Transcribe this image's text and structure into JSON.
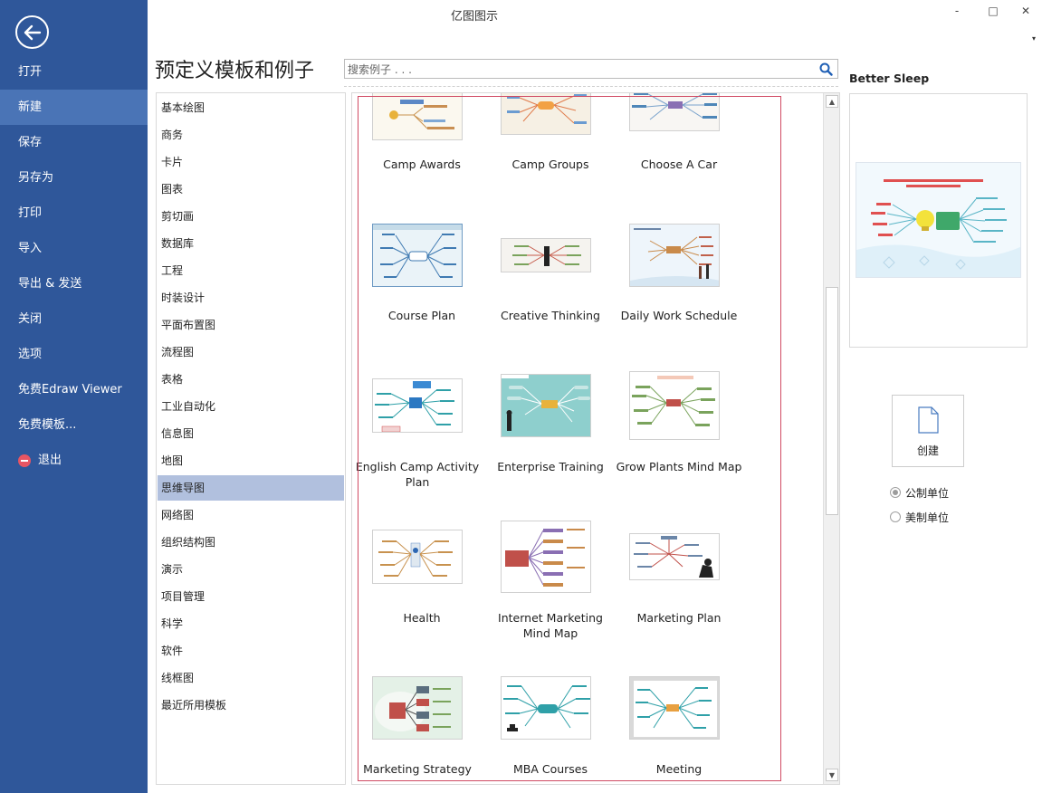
{
  "window": {
    "title": "亿图图示",
    "minimize": "-",
    "maximize": "□",
    "close": "✕",
    "ribbon_toggle": "▾"
  },
  "sidebar": {
    "back_icon": "arrow-left-circle-icon",
    "items": [
      {
        "label": "打开"
      },
      {
        "label": "新建"
      },
      {
        "label": "保存"
      },
      {
        "label": "另存为"
      },
      {
        "label": "打印"
      },
      {
        "label": "导入"
      },
      {
        "label": "导出 & 发送"
      },
      {
        "label": "关闭"
      },
      {
        "label": "选项"
      },
      {
        "label": "免费Edraw Viewer"
      },
      {
        "label": "免费模板..."
      },
      {
        "label": "退出"
      }
    ],
    "active_index": 1,
    "colors": {
      "background": "#2f579a",
      "active": "#4a74b6",
      "exit_icon": "#e75563"
    }
  },
  "page": {
    "title": "预定义模板和例子",
    "search_placeholder": "搜索例子 . . ."
  },
  "categories": {
    "items": [
      "基本绘图",
      "商务",
      "卡片",
      "图表",
      "剪切画",
      "数据库",
      "工程",
      "时装设计",
      "平面布置图",
      "流程图",
      "表格",
      "工业自动化",
      "信息图",
      "地图",
      "思维导图",
      "网络图",
      "组织结构图",
      "演示",
      "项目管理",
      "科学",
      "软件",
      "线框图",
      "最近所用模板"
    ],
    "active_index": 14,
    "active_color": "#b1c0de"
  },
  "templates": [
    {
      "label": "Camp Awards"
    },
    {
      "label": "Camp Groups"
    },
    {
      "label": "Choose A Car"
    },
    {
      "label": "Course Plan"
    },
    {
      "label": "Creative Thinking"
    },
    {
      "label": "Daily Work Schedule"
    },
    {
      "label": "English Camp Activity Plan"
    },
    {
      "label": "Enterprise Training"
    },
    {
      "label": "Grow Plants Mind Map"
    },
    {
      "label": "Health"
    },
    {
      "label": "Internet Marketing Mind Map"
    },
    {
      "label": "Marketing Plan"
    },
    {
      "label": "Marketing Strategy"
    },
    {
      "label": "MBA Courses"
    },
    {
      "label": "Meeting"
    }
  ],
  "preview": {
    "title": "Better Sleep",
    "create_label": "创建",
    "units": [
      {
        "label": "公制单位",
        "checked": true
      },
      {
        "label": "美制单位",
        "checked": false
      }
    ]
  },
  "scrollbar": {
    "up": "▲",
    "down": "▼"
  },
  "colors": {
    "selection_frame": "#d04a63"
  }
}
